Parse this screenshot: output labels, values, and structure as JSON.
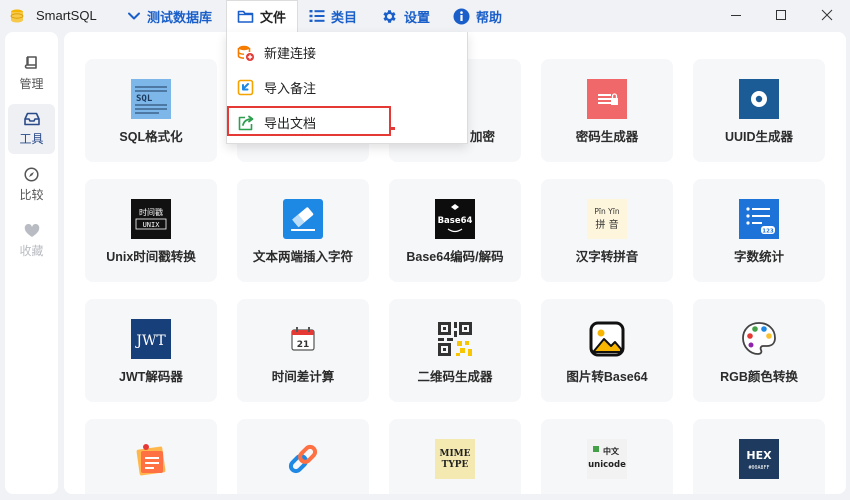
{
  "app": {
    "title": "SmartSQL"
  },
  "menubar": {
    "items": [
      {
        "label": "测试数据库",
        "icon": "chevron-down-icon"
      },
      {
        "label": "文件",
        "icon": "folder-icon"
      },
      {
        "label": "类目",
        "icon": "list-icon"
      },
      {
        "label": "设置",
        "icon": "gear-icon"
      },
      {
        "label": "帮助",
        "icon": "info-icon"
      }
    ]
  },
  "window_controls": [
    "minimize",
    "maximize",
    "close"
  ],
  "sidebar": {
    "items": [
      {
        "label": "管理",
        "icon": "book-icon",
        "state": "normal"
      },
      {
        "label": "工具",
        "icon": "inbox-icon",
        "state": "active"
      },
      {
        "label": "比较",
        "icon": "compass-icon",
        "state": "normal"
      },
      {
        "label": "收藏",
        "icon": "heart-icon",
        "state": "disabled"
      }
    ]
  },
  "file_menu": {
    "items": [
      {
        "label": "新建连接",
        "icon": "database-add-icon"
      },
      {
        "label": "导入备注",
        "icon": "import-icon"
      },
      {
        "label": "导出文档",
        "icon": "export-icon",
        "highlighted": true
      }
    ]
  },
  "tools": {
    "rows": [
      [
        {
          "label": "SQL格式化",
          "icon": "sql-format-icon"
        },
        {
          "label": "",
          "icon": "hidden-tool-icon"
        },
        {
          "label": "加密",
          "icon": "hidden-tool-icon"
        },
        {
          "label": "密码生成器",
          "icon": "password-icon"
        },
        {
          "label": "UUID生成器",
          "icon": "uuid-icon"
        }
      ],
      [
        {
          "label": "Unix时间戳转换",
          "icon": "timestamp-icon"
        },
        {
          "label": "文本两端插入字符",
          "icon": "eraser-icon"
        },
        {
          "label": "Base64编码/解码",
          "icon": "base64-icon"
        },
        {
          "label": "汉字转拼音",
          "icon": "pinyin-icon"
        },
        {
          "label": "字数统计",
          "icon": "word-count-icon"
        }
      ],
      [
        {
          "label": "JWT解码器",
          "icon": "jwt-icon"
        },
        {
          "label": "时间差计算",
          "icon": "calendar-icon"
        },
        {
          "label": "二维码生成器",
          "icon": "qrcode-icon"
        },
        {
          "label": "图片转Base64",
          "icon": "image-icon"
        },
        {
          "label": "RGB颜色转换",
          "icon": "palette-icon"
        }
      ],
      [
        {
          "label": "",
          "icon": "sticky-note-icon"
        },
        {
          "label": "",
          "icon": "link-icon"
        },
        {
          "label": "",
          "icon": "mime-type-icon",
          "icon_text": [
            "MIME",
            "TYPE"
          ]
        },
        {
          "label": "",
          "icon": "unicode-icon",
          "icon_text": [
            "中文",
            "unicode"
          ]
        },
        {
          "label": "",
          "icon": "hex-icon",
          "icon_text": [
            "HEX",
            "#00A8FF"
          ]
        }
      ]
    ],
    "icon_text": {
      "sql": "SQL",
      "timestamp": [
        "时间戳",
        "UNIX"
      ],
      "base64": "Base64",
      "pinyin": [
        "Pīn Yīn",
        "拼 音"
      ],
      "word_count": "123",
      "jwt": "JWT",
      "calendar": "21"
    }
  },
  "colors": {
    "accent": "#1a5fc9",
    "highlight": "#e53935",
    "sidebar_active_bg": "#eef0f4"
  }
}
